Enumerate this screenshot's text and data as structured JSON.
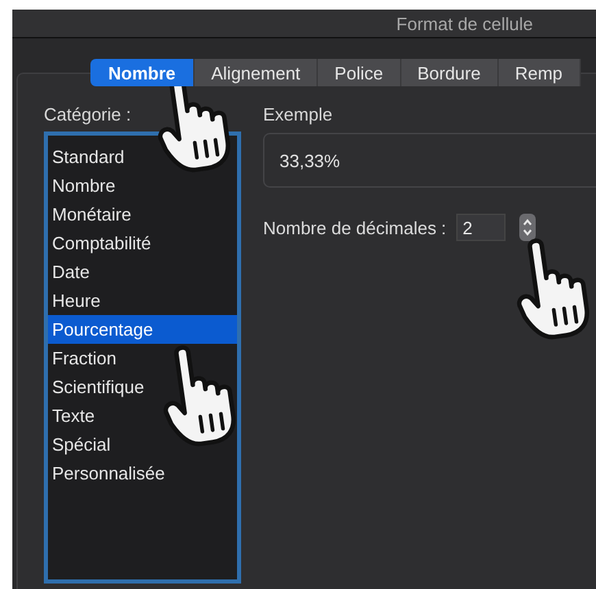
{
  "window": {
    "title": "Format de cellule"
  },
  "tabs": [
    {
      "label": "Nombre",
      "selected": true
    },
    {
      "label": "Alignement",
      "selected": false
    },
    {
      "label": "Police",
      "selected": false
    },
    {
      "label": "Bordure",
      "selected": false
    },
    {
      "label": "Remp",
      "selected": false
    }
  ],
  "category": {
    "label": "Catégorie :",
    "items": [
      {
        "label": "Standard",
        "selected": false
      },
      {
        "label": "Nombre",
        "selected": false
      },
      {
        "label": "Monétaire",
        "selected": false
      },
      {
        "label": "Comptabilité",
        "selected": false
      },
      {
        "label": "Date",
        "selected": false
      },
      {
        "label": "Heure",
        "selected": false
      },
      {
        "label": "Pourcentage",
        "selected": true
      },
      {
        "label": "Fraction",
        "selected": false
      },
      {
        "label": "Scientifique",
        "selected": false
      },
      {
        "label": "Texte",
        "selected": false
      },
      {
        "label": "Spécial",
        "selected": false
      },
      {
        "label": "Personnalisée",
        "selected": false
      }
    ]
  },
  "example": {
    "label": "Exemple",
    "value": "33,33%"
  },
  "decimals": {
    "label": "Nombre de décimales :",
    "value": "2"
  }
}
